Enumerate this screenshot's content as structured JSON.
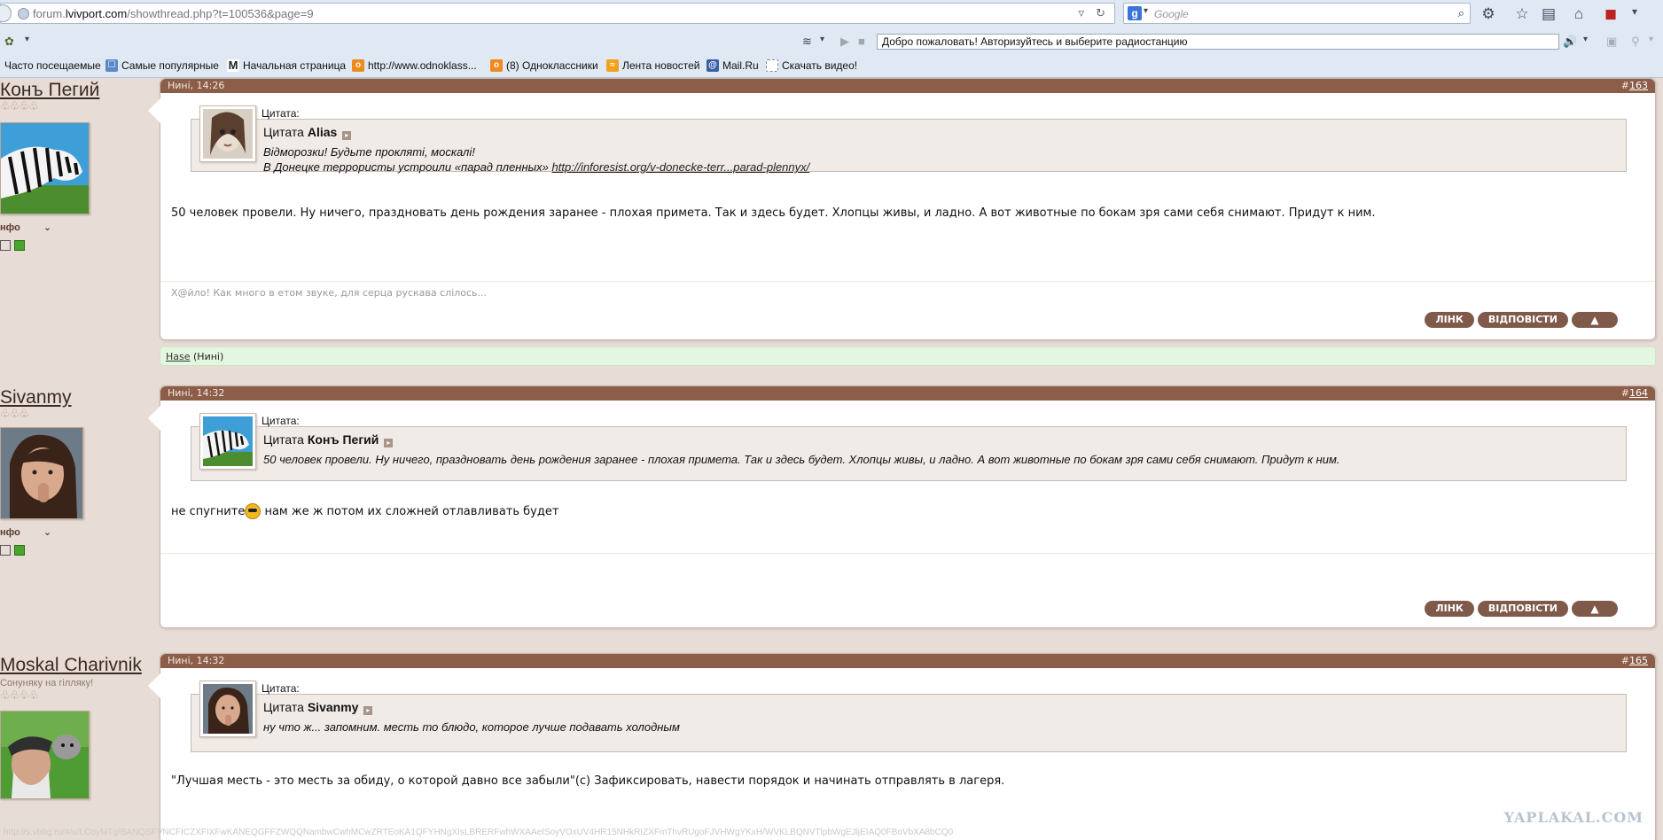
{
  "browser": {
    "url_prefix": "forum.",
    "url_domain": "lvivport.com",
    "url_path": "/showthread.php?t=100536&page=9",
    "search_placeholder": "Google",
    "radio_text": "Добро пожаловать! Авторизуйтесь и выберите радиостанцию",
    "bookmarks": [
      {
        "label": "Часто посещаемые"
      },
      {
        "label": "Самые популярные"
      },
      {
        "label": "Начальная страница"
      },
      {
        "label": "http://www.odnoklass..."
      },
      {
        "label": "(8) Одноклассники"
      },
      {
        "label": "Лента новостей"
      },
      {
        "label": "Mail.Ru"
      },
      {
        "label": "Скачать видео!"
      }
    ]
  },
  "posts": [
    {
      "time": "Нині, 14:26",
      "num_prefix": "#",
      "num": "163",
      "username": "Конъ Пегий",
      "user_title": "",
      "stars": "♧♧♧♧",
      "info_label": "нфо",
      "quote_label": "Цитата:",
      "quote_prefix": "Цитата",
      "quote_author": "Alias",
      "quote_lines": [
        "Відморозки! Будьте прокляті, москалі!",
        "В Донецке террористы устроили «парад пленных»"
      ],
      "quote_link": "http://inforesist.org/v-donecke-terr...parad-plennyx/",
      "text": "50 человек провели. Ну ничего, праздновать день рождения заранее - плохая примета. Так и здесь будет. Хлопцы живы, и ладно. А вот животные по бокам зря сами себя снимают. Придут к ним.",
      "signature": "Х@йло! Как много в етом звуке, для серца рускава слілось...",
      "btn_link": "ЛІНК",
      "btn_reply": "ВІДПОВІСТИ",
      "btn_up": "▲"
    },
    {
      "time": "Нині, 14:32",
      "num_prefix": "#",
      "num": "164",
      "username": "Sivanmy",
      "user_title": "",
      "stars": "♧♧♧",
      "info_label": "нфо",
      "quote_label": "Цитата:",
      "quote_prefix": "Цитата",
      "quote_author": "Конъ Пегий",
      "quote_lines": [
        "50 человек провели. Ну ничего, праздновать день рождения заранее - плохая примета. Так и здесь будет. Хлопцы живы, и ладно. А вот животные по бокам зря сами себя снимают. Придут к ним."
      ],
      "quote_link": "",
      "text_before": "не спугните",
      "text_after": " нам же ж потом их сложней отлавливать будет",
      "btn_link": "ЛІНК",
      "btn_reply": "ВІДПОВІСТИ",
      "btn_up": "▲"
    },
    {
      "time": "Нині, 14:32",
      "num_prefix": "#",
      "num": "165",
      "username": "Moskal Charivnik",
      "user_title": "Сонуняку на гілляку!",
      "stars": "♧♧♧♧",
      "info_label": "нфо",
      "quote_label": "Цитата:",
      "quote_prefix": "Цитата",
      "quote_author": "Sivanmy",
      "quote_lines": [
        "ну что ж... запомним. месть то блюдо, которое лучше подавать холодным"
      ],
      "quote_link": "",
      "text": "\"Лучшая месть - это месть за обиду, о которой давно все забыли\"(с) Зафиксировать, навести порядок и начинать отправлять в лагеря."
    }
  ],
  "thanks": {
    "user": "Hase",
    "when": " (Нині)"
  },
  "watermark": "YAPLAKAL.COM",
  "status_url": "http://s.vbbg.ru/#/u/LCoyMTg/BANQSFVNCFICZXFIXFwKANEQGFFZWQQNambwCwhMCwZRTEoKA1QFYHNgXIsLBRERFwhWXAAeISoyVOxUV4HR15NHkRIZXFmThvRUgoFJVHWgYKxH/WVKLBQNVTlpbWgEJljEIAQ0FBoVbXA8bCQ0"
}
